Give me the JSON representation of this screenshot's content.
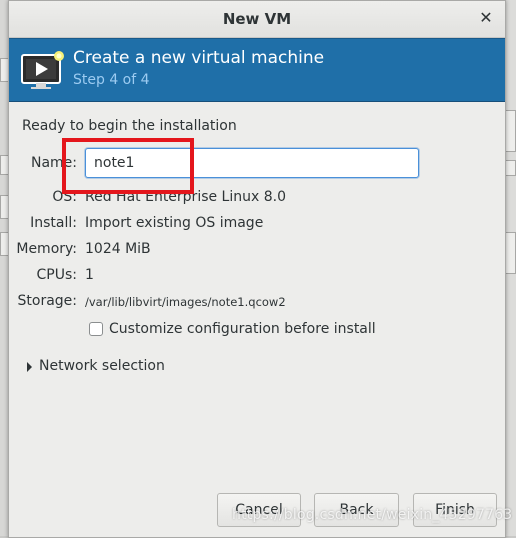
{
  "window": {
    "title": "New VM",
    "close_icon": "close-icon"
  },
  "banner": {
    "title": "Create a new virtual machine",
    "step": "Step 4 of 4",
    "icon": "monitor-sparkle-icon",
    "background_color": "#1f6fa8"
  },
  "summary": {
    "heading": "Ready to begin the installation",
    "name_label": "Name:",
    "name_value": "note1",
    "os_label": "OS:",
    "os_value": "Red Hat Enterprise Linux 8.0",
    "install_label": "Install:",
    "install_value": "Import existing OS image",
    "memory_label": "Memory:",
    "memory_value": "1024 MiB",
    "cpus_label": "CPUs:",
    "cpus_value": "1",
    "storage_label": "Storage:",
    "storage_value": "/var/lib/libvirt/images/note1.qcow2"
  },
  "options": {
    "customize_label": "Customize configuration before install",
    "customize_checked": false,
    "network_label": "Network selection"
  },
  "buttons": {
    "cancel": "Cancel",
    "back": "Back",
    "finish": "Finish"
  },
  "annotation": {
    "color": "#e4161c"
  },
  "watermark": "https://blog.csdn.net/weixin_45297763"
}
